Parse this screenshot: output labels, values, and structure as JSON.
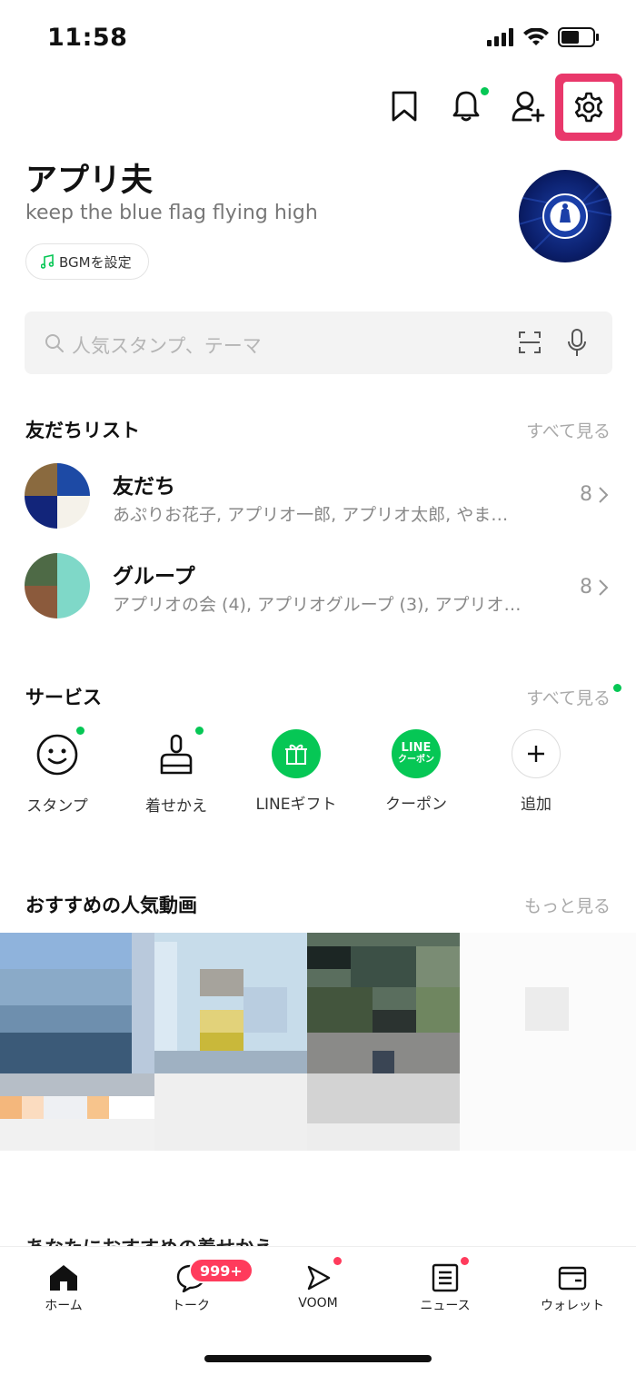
{
  "status_bar": {
    "time": "11:58"
  },
  "profile": {
    "name": "アプリ夫",
    "status": "keep the blue flag flying high",
    "bgm_label": "BGMを設定"
  },
  "search": {
    "placeholder": "人気スタンプ、テーマ"
  },
  "friends_section": {
    "title": "友だちリスト",
    "see_all": "すべて見る",
    "rows": [
      {
        "title": "友だち",
        "subtitle": "あぷりお花子, アプリオ一郎, アプリオ太郎, やま…",
        "count": "8"
      },
      {
        "title": "グループ",
        "subtitle": "アプリオの会 (4), アプリオグループ (3), アプリオ…",
        "count": "8"
      }
    ]
  },
  "services_section": {
    "title": "サービス",
    "see_all": "すべて見る",
    "items": [
      {
        "label": "スタンプ",
        "icon": "smiley-icon"
      },
      {
        "label": "着せかえ",
        "icon": "brush-icon"
      },
      {
        "label": "LINEギフト",
        "icon": "gift-icon",
        "color": "#06c755"
      },
      {
        "label": "クーポン",
        "icon": "coupon-icon",
        "color": "#06c755",
        "badge_top": "LINE",
        "badge_bottom": "クーポン"
      },
      {
        "label": "追加",
        "icon": "plus-icon"
      }
    ]
  },
  "videos_section": {
    "title": "おすすめの人気動画",
    "see_more": "もっと見る"
  },
  "next_section_peek": "あなたにおすすめの着せかえ",
  "tabbar": {
    "tabs": [
      {
        "label": "ホーム",
        "icon": "home-icon"
      },
      {
        "label": "トーク",
        "icon": "chat-icon",
        "badge": "999+"
      },
      {
        "label": "VOOM",
        "icon": "voom-icon"
      },
      {
        "label": "ニュース",
        "icon": "news-icon"
      },
      {
        "label": "ウォレット",
        "icon": "wallet-icon"
      }
    ]
  },
  "colors": {
    "accent_green": "#06c755",
    "highlight_pink": "#e9386b",
    "badge_red": "#ff3b5c"
  }
}
